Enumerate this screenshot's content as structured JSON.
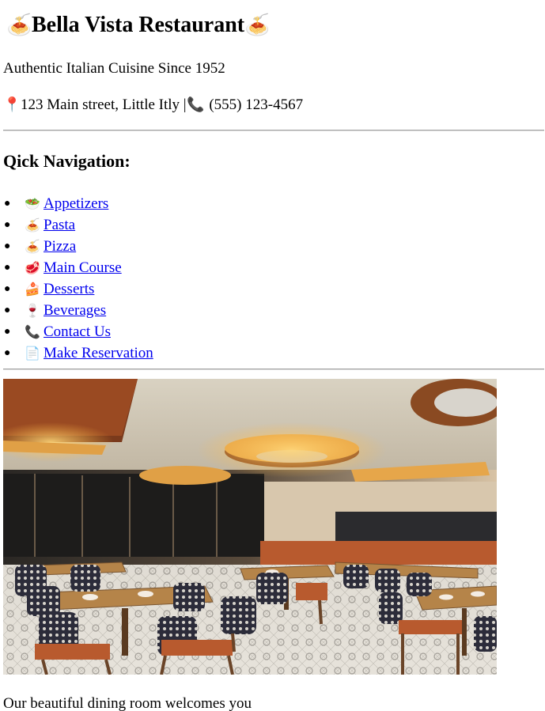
{
  "header": {
    "title": "Bella Vista Restaurant",
    "title_icon": "spaghetti-icon",
    "tagline": "Authentic Italian Cuisine Since 1952",
    "address_icon": "map-pin-icon",
    "address": "123 Main street, Little Itly",
    "separator": "|",
    "phone_icon": "telephone-icon",
    "phone": "(555) 123-4567"
  },
  "navigation": {
    "heading": "Qick Navigation:",
    "items": [
      {
        "icon": "salad-icon",
        "emoji": "🥗",
        "label": "Appetizers"
      },
      {
        "icon": "spaghetti-icon",
        "emoji": "🍝",
        "label": "Pasta"
      },
      {
        "icon": "spaghetti-icon",
        "emoji": "🍝",
        "label": "Pizza"
      },
      {
        "icon": "meat-icon",
        "emoji": "🥩",
        "label": "Main Course"
      },
      {
        "icon": "cake-icon",
        "emoji": "🍰",
        "label": "Desserts"
      },
      {
        "icon": "wine-glass-icon",
        "emoji": "🍷",
        "label": "Beverages"
      },
      {
        "icon": "telephone-icon",
        "emoji": "📞",
        "label": "Contact Us"
      },
      {
        "icon": "document-icon",
        "emoji": "📄",
        "label": "Make Reservation"
      }
    ]
  },
  "hero": {
    "image_subject": "restaurant dining room interior",
    "caption": "Our beautiful dining room welcomes you"
  },
  "colors": {
    "link": "#0000ee",
    "text": "#000000",
    "divider": "#a0a0a0"
  }
}
